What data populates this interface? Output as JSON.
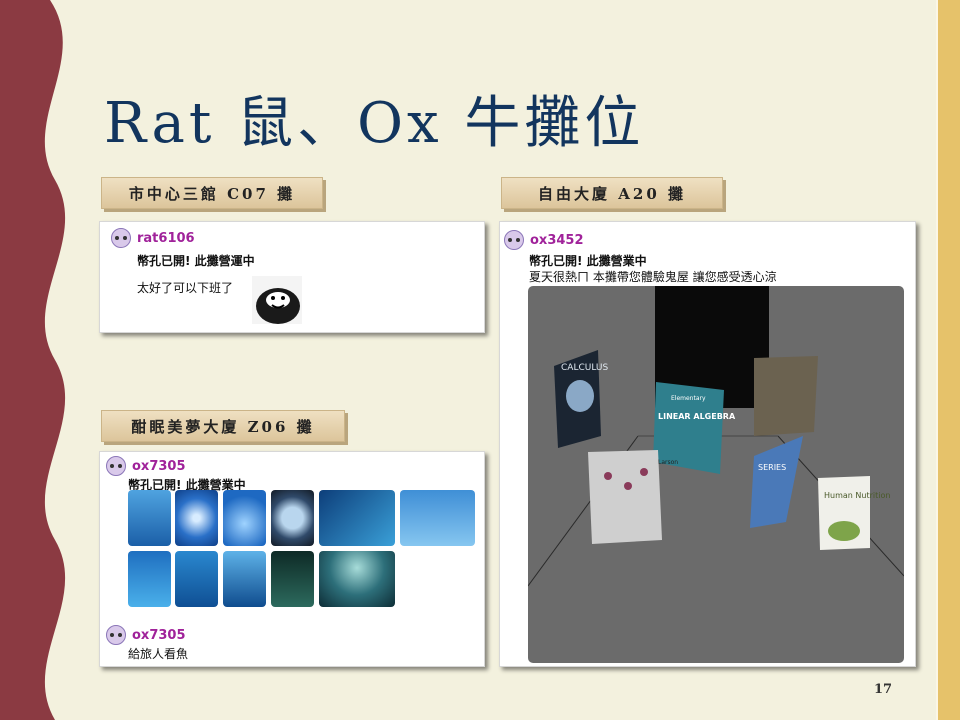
{
  "title": "Rat 鼠、Ox 牛攤位",
  "slide_number": "17",
  "stalls": {
    "c07": {
      "label": "市中心三館 C07 攤",
      "user": "rat6106",
      "status": "幣孔已開! 此攤營運中",
      "message": "太好了可以下班了"
    },
    "z06": {
      "label": "酣眠美夢大廈 Z06 攤",
      "user": "ox7305",
      "status": "幣孔已開! 此攤營業中",
      "photos_count": 11,
      "user2": "ox7305",
      "message": "給旅人看魚"
    },
    "a20": {
      "label": "自由大廈 A20 攤",
      "user": "ox3452",
      "status": "幣孔已開! 此攤營業中",
      "message": "夏天很熱ㄇ 本攤帶您體驗鬼屋 讓您感受透心涼",
      "books": {
        "calculus": "CALCULUS",
        "linear_algebra_top": "Elementary",
        "linear_algebra": "LINEAR ALGEBRA",
        "linear_algebra_author": "Larson",
        "nutrition": "Human Nutrition",
        "series": "SERIES"
      }
    }
  },
  "colors": {
    "background": "#f3f1de",
    "wave": "#8b3a42",
    "title": "#12355e",
    "username": "#a0229a",
    "right_band": "#e6c26a"
  }
}
